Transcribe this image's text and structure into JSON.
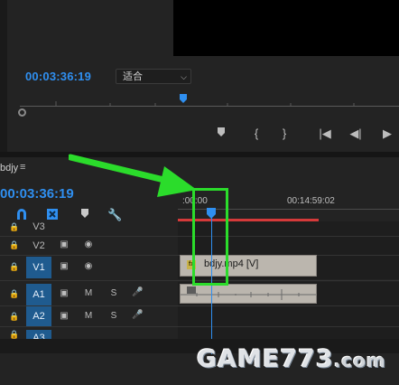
{
  "program_monitor": {
    "timecode": "00:03:36:19",
    "zoom_select": "适合"
  },
  "transport": {
    "add_marker_icon": "marker-icon",
    "mark_in_icon": "mark-in-icon",
    "mark_out_icon": "mark-out-icon",
    "go_to_in_icon": "go-to-in-icon",
    "step_back_icon": "step-back-icon",
    "play_icon": "play-icon"
  },
  "timeline": {
    "sequence_name": "bdjy",
    "timecode": "00:03:36:19",
    "ruler": {
      "start": ":00:00",
      "tick": "00:14:59:02"
    },
    "tracks": [
      {
        "label": "V3",
        "selected": false
      },
      {
        "label": "V2",
        "selected": false
      },
      {
        "label": "V1",
        "selected": true
      },
      {
        "label": "A1",
        "selected": true
      },
      {
        "label": "A2",
        "selected": true
      },
      {
        "label": "A3",
        "selected": true
      }
    ],
    "track_buttons": {
      "mute": "M",
      "solo": "S"
    },
    "video_clip": {
      "fx_badge": "fx",
      "name": "bdjy.mp4 [V]"
    }
  },
  "watermark": {
    "main": "GAME773",
    "suffix": ".com"
  },
  "colors": {
    "accent_blue": "#2f8ff0",
    "highlight_green": "#2bdc2b",
    "work_area_red": "#d53a3a",
    "track_selected": "#1f5b8f"
  }
}
